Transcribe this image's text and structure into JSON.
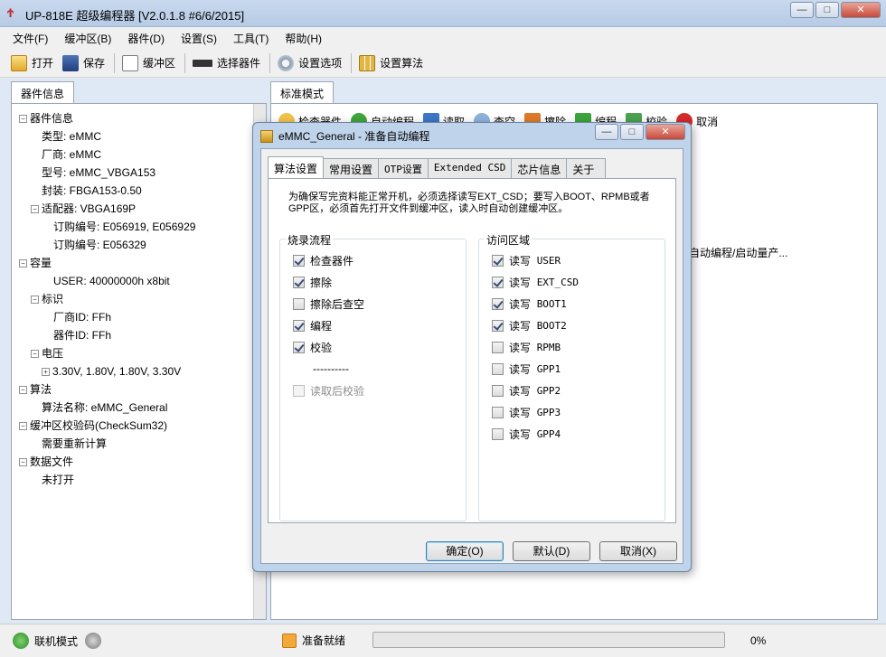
{
  "window": {
    "title": "UP-818E 超级编程器  [V2.0.1.8 #6/6/2015]",
    "buttons": {
      "minimize": "—",
      "maximize": "□",
      "close": "✕"
    }
  },
  "menu": [
    "文件(F)",
    "缓冲区(B)",
    "器件(D)",
    "设置(S)",
    "工具(T)",
    "帮助(H)"
  ],
  "toolbar": {
    "open": "打开",
    "save": "保存",
    "buffer": "缓冲区",
    "select_device": "选择器件",
    "settings": "设置选项",
    "algorithm": "设置算法"
  },
  "left_tab": "器件信息",
  "tree": [
    {
      "text": "器件信息",
      "level": 0,
      "expander": "−"
    },
    {
      "text": "类型: eMMC",
      "level": 1
    },
    {
      "text": "厂商: eMMC",
      "level": 1
    },
    {
      "text": "型号: eMMC_VBGA153",
      "level": 1
    },
    {
      "text": "封装: FBGA153-0.50",
      "level": 1
    },
    {
      "text": "适配器: VBGA169P",
      "level": 1,
      "expander": "−"
    },
    {
      "text": "订购编号: E056919, E056929",
      "level": 2
    },
    {
      "text": "订购编号: E056329",
      "level": 2
    },
    {
      "text": "容量",
      "level": 0,
      "expander": "−"
    },
    {
      "text": "USER: 40000000h x8bit",
      "level": 2
    },
    {
      "text": "标识",
      "level": 0,
      "expander": "−"
    },
    {
      "text": "厂商ID: FFh",
      "level": 2
    },
    {
      "text": "器件ID: FFh",
      "level": 2
    },
    {
      "text": "电压",
      "level": 0,
      "expander": "−"
    },
    {
      "text": "3.30V, 1.80V, 1.80V, 3.30V",
      "level": 1,
      "expander": "+"
    },
    {
      "text": "算法",
      "level": 0,
      "expander": "−"
    },
    {
      "text": "算法名称: eMMC_General",
      "level": 1
    },
    {
      "text": "缓冲区校验码(CheckSum32)",
      "level": 0,
      "expander": "−"
    },
    {
      "text": "需要重新计算",
      "level": 1
    },
    {
      "text": "数据文件",
      "level": 0,
      "expander": "−"
    },
    {
      "text": "未打开",
      "level": 1
    }
  ],
  "right_tab": "标准模式",
  "right_toolbar": {
    "check": "检查器件",
    "auto": "自动编程",
    "read": "读取",
    "blank": "查空",
    "erase": "擦除",
    "program": "编程",
    "verify": "校验",
    "cancel": "取消"
  },
  "right_hint": "自动编程/启动量产...",
  "status": {
    "mode": "联机模式",
    "ready": "准备就绪",
    "progress_value": 0,
    "progress_text": "0%"
  },
  "dialog": {
    "title": "eMMC_General - 准备自动编程",
    "tabs": [
      "算法设置",
      "常用设置",
      "OTP设置",
      "Extended CSD",
      "芯片信息",
      "关于"
    ],
    "note": "为确保写完资料能正常开机，必须选择读写EXT_CSD；要写入BOOT、RPMB或者GPP区，必须首先打开文件到缓冲区，读入时自动创建缓冲区。",
    "flow_group": "烧录流程",
    "flow": [
      {
        "label": "检查器件",
        "checked": true
      },
      {
        "label": "擦除",
        "checked": true
      },
      {
        "label": "擦除后查空",
        "checked": false
      },
      {
        "label": "编程",
        "checked": true
      },
      {
        "label": "校验",
        "checked": true
      }
    ],
    "separator": "----------",
    "read_verify": {
      "label": "读取后校验",
      "checked": false
    },
    "area_group": "访问区域",
    "areas": [
      {
        "label": "读写",
        "code": "USER",
        "checked": true
      },
      {
        "label": "读写",
        "code": "EXT_CSD",
        "checked": true
      },
      {
        "label": "读写",
        "code": "BOOT1",
        "checked": true
      },
      {
        "label": "读写",
        "code": "BOOT2",
        "checked": true
      },
      {
        "label": "读写",
        "code": "RPMB",
        "checked": false
      },
      {
        "label": "读写",
        "code": "GPP1",
        "checked": false
      },
      {
        "label": "读写",
        "code": "GPP2",
        "checked": false
      },
      {
        "label": "读写",
        "code": "GPP3",
        "checked": false
      },
      {
        "label": "读写",
        "code": "GPP4",
        "checked": false
      }
    ],
    "ok": "确定(O)",
    "default": "默认(D)",
    "cancel": "取消(X)"
  }
}
